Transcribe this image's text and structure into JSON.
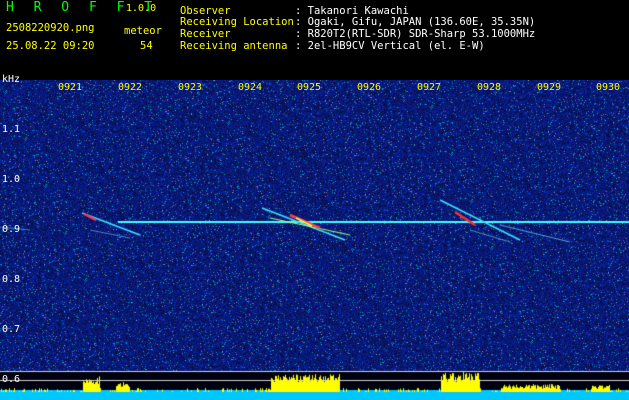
{
  "header": {
    "title": "H R O F F T",
    "version": "1.0.0",
    "filename": "2508220920.png",
    "datetime": "25.08.22 09:20",
    "meteor_label": "meteor",
    "meteor_count": "54"
  },
  "info": {
    "labels": [
      "Observer",
      "Receiving Location",
      "Receiver",
      "Receiving antenna"
    ],
    "values": [
      ": Takanori Kawachi",
      ": Ogaki, Gifu, JAPAN (136.60E, 35.35N)",
      ": R820T2(RTL-SDR) SDR-Sharp 53.1000MHz",
      ": 2el-HB9CV Vertical (el. E-W)"
    ]
  },
  "axis": {
    "unit": "kHz",
    "y_ticks": [
      "1.1",
      "1.0",
      "0.9",
      "0.8",
      "0.7",
      "0.6"
    ],
    "x_ticks": [
      "0921",
      "0922",
      "0923",
      "0924",
      "0925",
      "0926",
      "0927",
      "0928",
      "0929",
      "0930"
    ]
  },
  "colors": {
    "background": "#000000",
    "noise": "#1a1aa8",
    "carrier": "#40ffff",
    "meteor": "#ff3030",
    "level": "#ffff00",
    "level_base": "#00c8ff"
  }
}
